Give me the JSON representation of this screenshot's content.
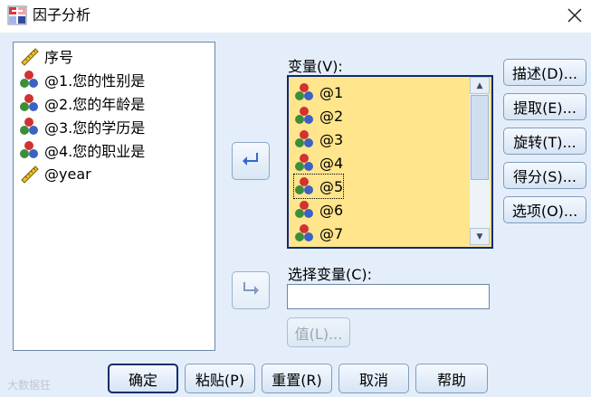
{
  "window": {
    "title": "因子分析",
    "app_icon": "spss-factor-icon",
    "close_icon": "close-icon"
  },
  "source_list": {
    "items": [
      {
        "label": "序号",
        "icon": "scale-ruler-icon"
      },
      {
        "label": "@1.您的性别是",
        "icon": "nominal-variable-icon"
      },
      {
        "label": "@2.您的年龄是",
        "icon": "nominal-variable-icon"
      },
      {
        "label": "@3.您的学历是",
        "icon": "nominal-variable-icon"
      },
      {
        "label": "@4.您的职业是",
        "icon": "nominal-variable-icon"
      },
      {
        "label": "@year",
        "icon": "scale-ruler-icon"
      }
    ]
  },
  "variables_panel": {
    "label": "变量(V):",
    "items": [
      {
        "label": "@1",
        "icon": "nominal-variable-icon"
      },
      {
        "label": "@2",
        "icon": "nominal-variable-icon"
      },
      {
        "label": "@3",
        "icon": "nominal-variable-icon"
      },
      {
        "label": "@4",
        "icon": "nominal-variable-icon"
      },
      {
        "label": "@5",
        "icon": "nominal-variable-icon"
      },
      {
        "label": "@6",
        "icon": "nominal-variable-icon"
      },
      {
        "label": "@7",
        "icon": "nominal-variable-icon"
      }
    ]
  },
  "selection_variable": {
    "label": "选择变量(C):",
    "value": "",
    "value_button": "值(L)..."
  },
  "side_buttons": [
    "描述(D)...",
    "提取(E)...",
    "旋转(T)...",
    "得分(S)...",
    "选项(O)..."
  ],
  "bottom_buttons": [
    "确定",
    "粘贴(P)",
    "重置(R)",
    "取消",
    "帮助"
  ],
  "watermark": "大数据狂"
}
